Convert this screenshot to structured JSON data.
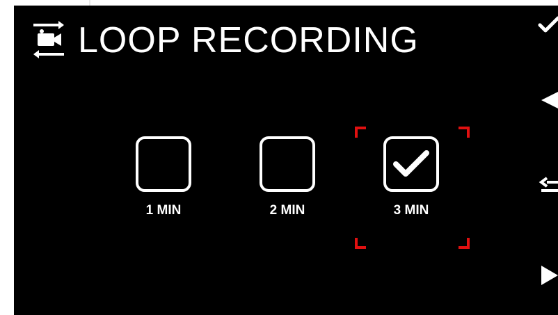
{
  "header": {
    "icon": "loop-recording-icon",
    "title": "LOOP RECORDING"
  },
  "options": [
    {
      "label": "1 MIN",
      "checked": false
    },
    {
      "label": "2 MIN",
      "checked": false
    },
    {
      "label": "3 MIN",
      "checked": true
    }
  ],
  "selected_option": "3 MIN",
  "side_buttons": [
    {
      "icon": "check-icon",
      "action": "confirm"
    },
    {
      "icon": "arrow-left-icon",
      "action": "previous"
    },
    {
      "icon": "swap-icon",
      "action": "toggle"
    },
    {
      "icon": "arrow-right-icon",
      "action": "next"
    }
  ],
  "colors": {
    "background": "#000000",
    "foreground": "#ffffff",
    "selection": "#e01010"
  }
}
